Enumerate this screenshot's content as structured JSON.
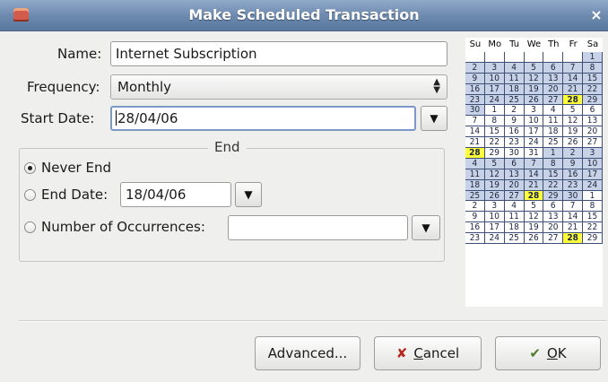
{
  "window": {
    "title": "Make Scheduled Transaction",
    "close_glyph": "×"
  },
  "form": {
    "name_label": "Name:",
    "name_value": "Internet Subscription",
    "frequency_label": "Frequency:",
    "frequency_value": "Monthly",
    "start_date_label": "Start Date:",
    "start_date_value": "28/04/06"
  },
  "end": {
    "title": "End",
    "never_end_label": "Never End",
    "end_date_label": "End Date:",
    "end_date_value": "18/04/06",
    "occurrences_label": "Number of Occurrences:",
    "occurrences_value": "",
    "selected": "never_end"
  },
  "buttons": {
    "advanced": "Advanced...",
    "cancel": "Cancel",
    "ok": "OK"
  },
  "calendar": {
    "weekdays": [
      "Su",
      "Mo",
      "Tu",
      "We",
      "Th",
      "Fr",
      "Sa"
    ],
    "highlight_color": "#ffff3a",
    "rows": [
      [
        "",
        "",
        "",
        "",
        "",
        "",
        "1"
      ],
      [
        "2",
        "3",
        "4",
        "5",
        "6",
        "7",
        "8"
      ],
      [
        "9",
        "10",
        "11",
        "12",
        "13",
        "14",
        "15"
      ],
      [
        "16",
        "17",
        "18",
        "19",
        "20",
        "21",
        "22"
      ],
      [
        "23",
        "24",
        "25",
        "26",
        "27",
        "28",
        "29"
      ],
      [
        "30",
        "1",
        "2",
        "3",
        "4",
        "5",
        "6"
      ],
      [
        "7",
        "8",
        "9",
        "10",
        "11",
        "12",
        "13"
      ],
      [
        "14",
        "15",
        "16",
        "17",
        "18",
        "19",
        "20"
      ],
      [
        "21",
        "22",
        "23",
        "24",
        "25",
        "26",
        "27"
      ],
      [
        "28",
        "29",
        "30",
        "31",
        "1",
        "2",
        "3"
      ],
      [
        "4",
        "5",
        "6",
        "7",
        "8",
        "9",
        "10"
      ],
      [
        "11",
        "12",
        "13",
        "14",
        "15",
        "16",
        "17"
      ],
      [
        "18",
        "19",
        "20",
        "21",
        "22",
        "23",
        "24"
      ],
      [
        "25",
        "26",
        "27",
        "28",
        "29",
        "30",
        "1"
      ],
      [
        "2",
        "3",
        "4",
        "5",
        "6",
        "7",
        "8"
      ],
      [
        "9",
        "10",
        "11",
        "12",
        "13",
        "14",
        "15"
      ],
      [
        "16",
        "17",
        "18",
        "19",
        "20",
        "21",
        "22"
      ],
      [
        "23",
        "24",
        "25",
        "26",
        "27",
        "28",
        "29"
      ]
    ],
    "highlighted": [
      [
        4,
        5
      ],
      [
        9,
        0
      ],
      [
        13,
        3
      ],
      [
        17,
        5
      ]
    ],
    "shaded_start": [
      [
        0,
        6
      ],
      [
        5,
        1
      ],
      [
        9,
        4
      ],
      [
        13,
        6
      ]
    ]
  }
}
